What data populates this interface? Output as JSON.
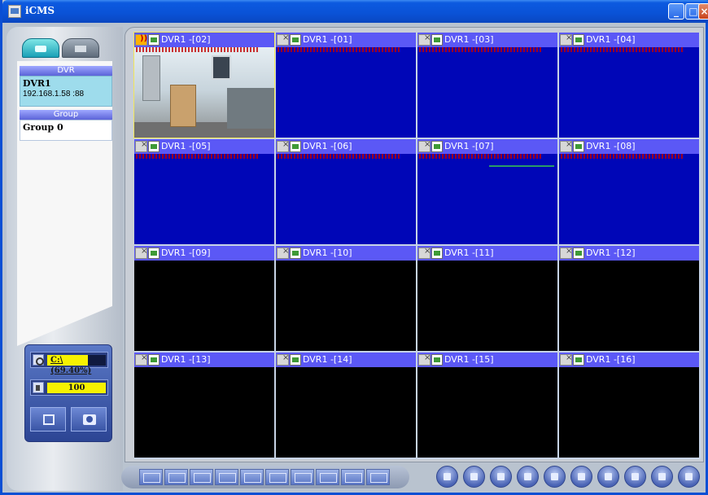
{
  "window": {
    "title": "iCMS",
    "controls": {
      "minimize": "_",
      "maximize": "□",
      "close": "×"
    }
  },
  "sidebar": {
    "tabs": [
      {
        "name": "camera-view-tab",
        "icon": "camera-icon",
        "selected": true
      },
      {
        "name": "settings-tab",
        "icon": "settings-icon",
        "selected": false
      }
    ],
    "dvr_section": {
      "header": "DVR",
      "name": "DVR1",
      "address": "192.168.1.58 :88"
    },
    "group_section": {
      "header": "Group",
      "name": "Group 0"
    },
    "disk": {
      "label": "C:\\ (69.40%)",
      "usage_percent": 69.4,
      "icon": "disk-icon"
    },
    "volume": {
      "value": "100",
      "level_percent": 100,
      "icon": "speaker-icon"
    },
    "controls": [
      {
        "name": "record-button",
        "icon": "film-icon"
      },
      {
        "name": "snapshot-button",
        "icon": "camera-icon"
      }
    ]
  },
  "grid": {
    "cells": [
      {
        "label": "DVR1 -[02]",
        "state": "live",
        "selected": true,
        "audio_active": true
      },
      {
        "label": "DVR1 -[01]",
        "state": "blue"
      },
      {
        "label": "DVR1 -[03]",
        "state": "blue"
      },
      {
        "label": "DVR1 -[04]",
        "state": "blue"
      },
      {
        "label": "DVR1 -[05]",
        "state": "blue"
      },
      {
        "label": "DVR1 -[06]",
        "state": "blue"
      },
      {
        "label": "DVR1 -[07]",
        "state": "blue",
        "motion_line": true
      },
      {
        "label": "DVR1 -[08]",
        "state": "blue"
      },
      {
        "label": "DVR1 -[09]",
        "state": "black"
      },
      {
        "label": "DVR1 -[10]",
        "state": "black"
      },
      {
        "label": "DVR1 -[11]",
        "state": "black"
      },
      {
        "label": "DVR1 -[12]",
        "state": "black"
      },
      {
        "label": "DVR1 -[13]",
        "state": "black"
      },
      {
        "label": "DVR1 -[14]",
        "state": "black"
      },
      {
        "label": "DVR1 -[15]",
        "state": "black"
      },
      {
        "label": "DVR1 -[16]",
        "state": "black"
      }
    ]
  },
  "toolbar": {
    "layout_buttons": [
      "layout-1",
      "layout-4",
      "layout-6",
      "layout-8",
      "layout-9",
      "layout-10",
      "layout-13",
      "layout-16",
      "layout-25",
      "layout-36"
    ],
    "action_buttons": [
      "play-icon",
      "record-icon",
      "search-icon",
      "backup-icon",
      "previous-icon",
      "next-icon",
      "sequence-icon",
      "save-icon",
      "snapshot-icon",
      "exit-icon"
    ]
  },
  "colors": {
    "titlebar": "#0a52d6",
    "cell_header": "#5b58f6",
    "no_signal_blue": "#0006b7",
    "selected_border": "#f1e65c",
    "meter_fill": "#f7f200"
  }
}
